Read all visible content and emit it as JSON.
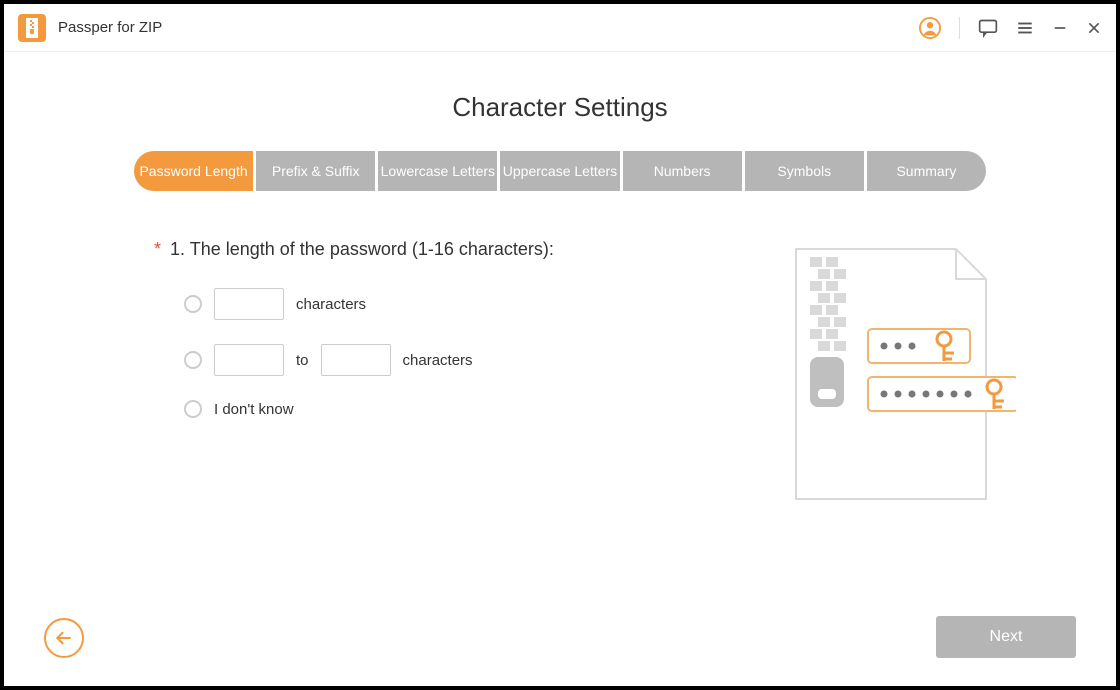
{
  "app": {
    "title": "Passper for ZIP"
  },
  "page": {
    "title": "Character Settings"
  },
  "tabs": [
    {
      "label": "Password Length",
      "active": true
    },
    {
      "label": "Prefix & Suffix",
      "active": false
    },
    {
      "label": "Lowercase Letters",
      "active": false
    },
    {
      "label": "Uppercase Letters",
      "active": false
    },
    {
      "label": "Numbers",
      "active": false
    },
    {
      "label": "Symbols",
      "active": false
    },
    {
      "label": "Summary",
      "active": false
    }
  ],
  "question": {
    "asterisk": "*",
    "text": "1. The length of the password (1-16 characters):"
  },
  "option_exact": {
    "suffix": "characters",
    "value": ""
  },
  "option_range": {
    "middle": "to",
    "suffix": "characters",
    "from": "",
    "to": ""
  },
  "option_unknown": {
    "label": "I don't know"
  },
  "footer": {
    "next": "Next"
  }
}
